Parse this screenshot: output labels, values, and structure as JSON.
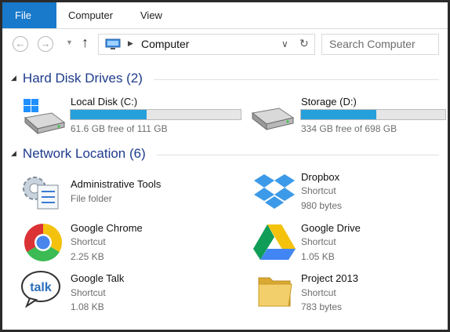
{
  "ribbon": {
    "tabs": [
      "File",
      "Computer",
      "View"
    ]
  },
  "address": {
    "path": "Computer",
    "search_placeholder": "Search Computer"
  },
  "groups": {
    "hard_disk": "Hard Disk Drives (2)",
    "network": "Network Location (6)"
  },
  "drives": [
    {
      "name": "Local Disk (C:)",
      "free": "61.6 GB free of 111 GB",
      "used_fraction": 0.445
    },
    {
      "name": "Storage (D:)",
      "free": "334 GB free of 698 GB",
      "used_fraction": 0.52
    }
  ],
  "network_items": [
    {
      "title": "Administrative Tools",
      "sub1": "File folder",
      "sub2": ""
    },
    {
      "title": "Dropbox",
      "sub1": "Shortcut",
      "sub2": "980 bytes"
    },
    {
      "title": "Google Chrome",
      "sub1": "Shortcut",
      "sub2": "2.25 KB"
    },
    {
      "title": "Google Drive",
      "sub1": "Shortcut",
      "sub2": "1.05 KB"
    },
    {
      "title": "Google Talk",
      "sub1": "Shortcut",
      "sub2": "1.08 KB"
    },
    {
      "title": "Project 2013",
      "sub1": "Shortcut",
      "sub2": "783 bytes"
    }
  ],
  "icons": {
    "back": "back-arrow-icon",
    "forward": "forward-arrow-icon",
    "up": "up-arrow-icon",
    "computer": "computer-icon",
    "refresh": "refresh-icon",
    "dropdown": "chevron-down-icon",
    "talk_label": "talk"
  },
  "colors": {
    "file_tab": "#1979ca",
    "group_heading": "#1e3b8c",
    "usage_fill": "#26a0da"
  }
}
